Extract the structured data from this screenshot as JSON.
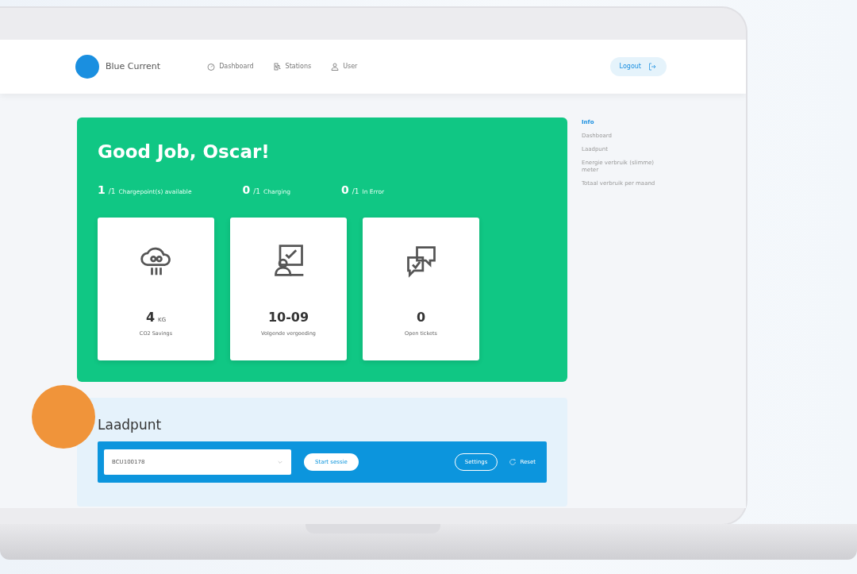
{
  "brand": "Blue Current",
  "nav": [
    {
      "label": "Dashboard"
    },
    {
      "label": "Stations"
    },
    {
      "label": "User"
    }
  ],
  "logout": "Logout",
  "greeting": "Good Job, Oscar!",
  "stats": [
    {
      "value": "1",
      "suffix": "/1",
      "label": "Chargepoint(s) available"
    },
    {
      "value": "0",
      "suffix": "/1",
      "label": "Charging"
    },
    {
      "value": "0",
      "suffix": "/1",
      "label": "In Error"
    }
  ],
  "tiles": [
    {
      "value": "4",
      "unit": "KG",
      "label": "CO2 Savings"
    },
    {
      "value": "10-09",
      "label": "Volgende vergoeding"
    },
    {
      "value": "0",
      "label": "Open tickets"
    }
  ],
  "side_menu": [
    {
      "label": "Info",
      "selected": true
    },
    {
      "label": "Dashboard",
      "selected": false
    },
    {
      "label": "Laadpunt",
      "selected": false
    },
    {
      "label": "Energie verbruik (slimme) meter",
      "selected": false
    },
    {
      "label": "Totaal verbruik per maand",
      "selected": false
    }
  ],
  "laadpunt": {
    "title": "Laadpunt",
    "chargepoint": "BCU100178",
    "start": "Start sessie",
    "settings": "Settings",
    "reset": "Reset"
  }
}
